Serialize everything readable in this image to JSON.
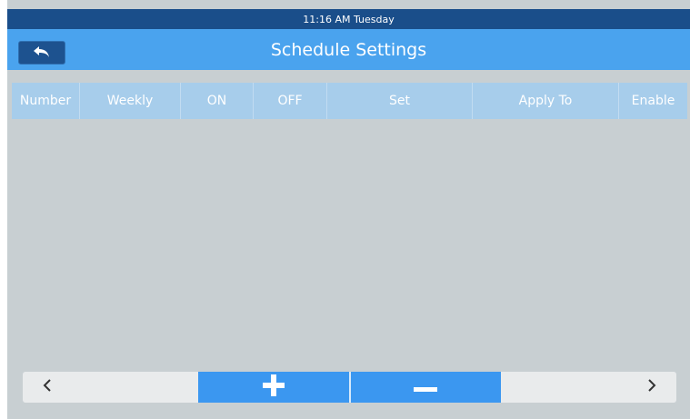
{
  "status_bar": {
    "time_text": "11:16 AM  Tuesday"
  },
  "header": {
    "title": "Schedule Settings",
    "back_icon": "back-arrow-icon"
  },
  "table": {
    "columns": [
      "Number",
      "Weekly",
      "ON",
      "OFF",
      "Set",
      "Apply To",
      "Enable"
    ],
    "rows": []
  },
  "pager": {
    "prev_icon": "chevron-left-icon",
    "add_icon": "plus-icon",
    "remove_icon": "minus-icon",
    "next_icon": "chevron-right-icon"
  },
  "colors": {
    "status_bar": "#1a4e8a",
    "title_bar": "#4aa3ee",
    "back_button": "#1d528f",
    "table_header": "#a7cdeb",
    "body_background": "#c8cfd2",
    "action_button": "#3b97f0",
    "nav_button": "#e9ebec"
  }
}
